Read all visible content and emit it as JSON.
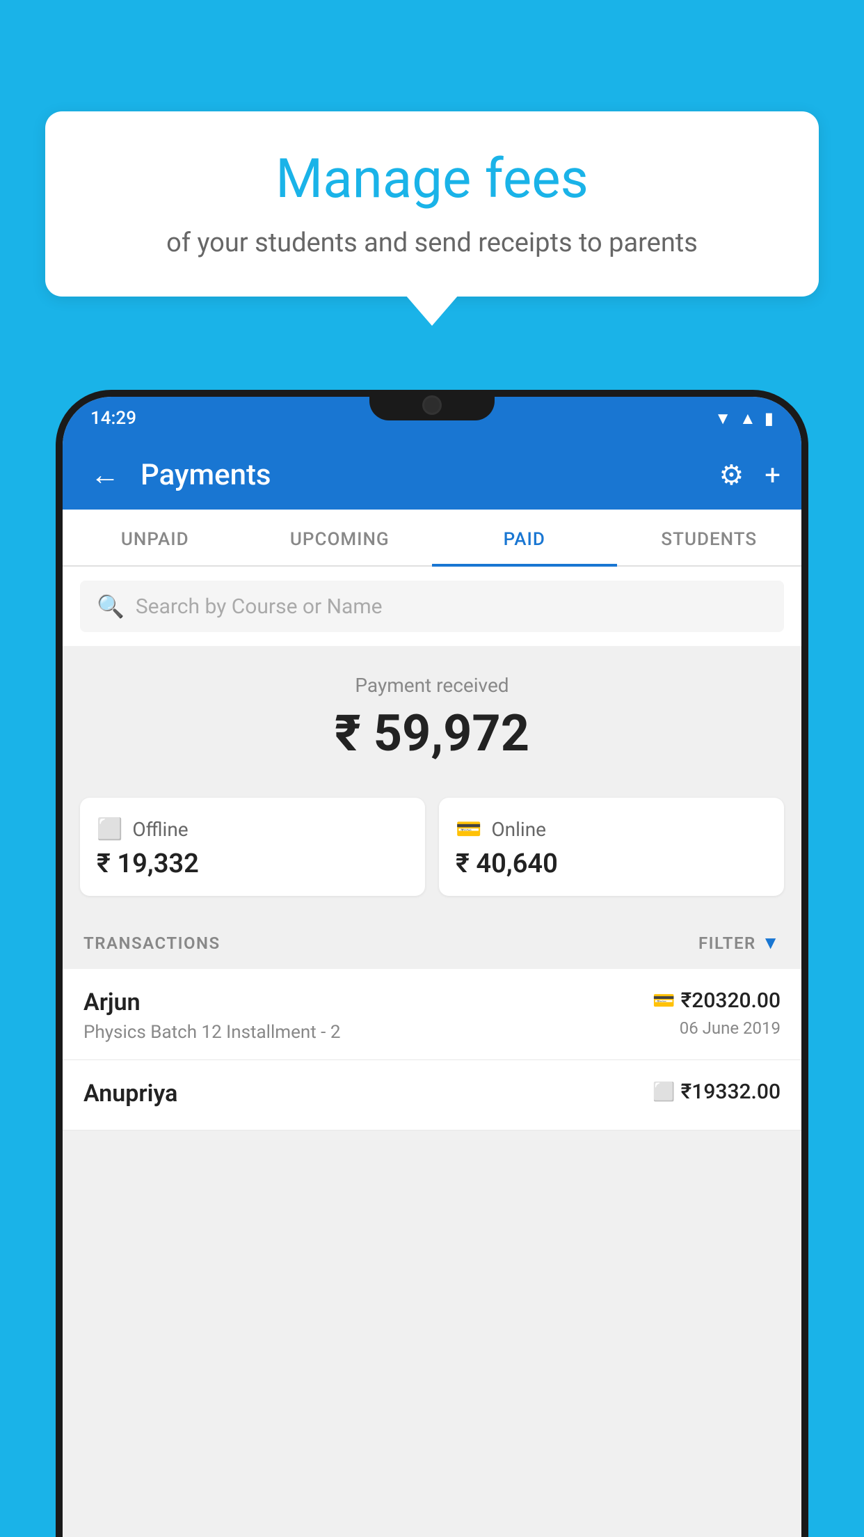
{
  "tooltip": {
    "title": "Manage fees",
    "subtitle": "of your students and send receipts to parents"
  },
  "statusBar": {
    "time": "14:29"
  },
  "appBar": {
    "title": "Payments",
    "backLabel": "←",
    "gearLabel": "⚙",
    "plusLabel": "+"
  },
  "tabs": [
    {
      "label": "UNPAID",
      "active": false
    },
    {
      "label": "UPCOMING",
      "active": false
    },
    {
      "label": "PAID",
      "active": true
    },
    {
      "label": "STUDENTS",
      "active": false
    }
  ],
  "search": {
    "placeholder": "Search by Course or Name"
  },
  "paymentReceived": {
    "label": "Payment received",
    "amount": "₹ 59,972"
  },
  "paymentCards": [
    {
      "type": "Offline",
      "amount": "₹ 19,332",
      "iconType": "offline"
    },
    {
      "type": "Online",
      "amount": "₹ 40,640",
      "iconType": "online"
    }
  ],
  "transactionsSection": {
    "label": "TRANSACTIONS",
    "filterLabel": "FILTER"
  },
  "transactions": [
    {
      "name": "Arjun",
      "course": "Physics Batch 12 Installment - 2",
      "amount": "₹20320.00",
      "date": "06 June 2019",
      "paymentType": "online"
    },
    {
      "name": "Anupriya",
      "course": "",
      "amount": "₹19332.00",
      "date": "",
      "paymentType": "offline"
    }
  ]
}
